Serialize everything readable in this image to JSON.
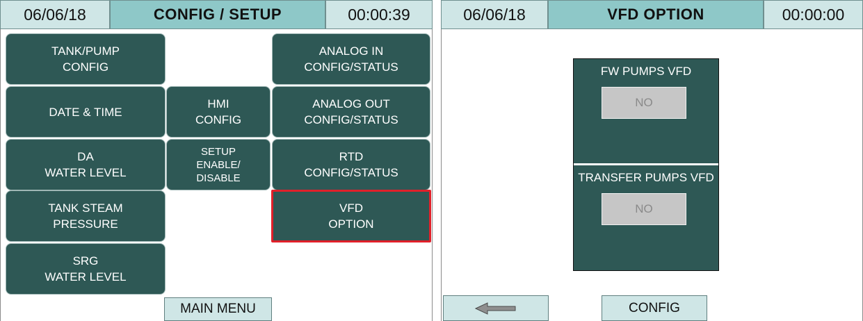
{
  "left": {
    "header": {
      "date": "06/06/18",
      "title": "CONFIG / SETUP",
      "time": "00:00:39"
    },
    "tiles": {
      "tank_pump": "TANK/PUMP\nCONFIG",
      "date_time": "DATE & TIME",
      "da_level": "DA\nWATER LEVEL",
      "tank_steam": "TANK STEAM\nPRESSURE",
      "srg_level": "SRG\nWATER LEVEL",
      "hmi_config": "HMI\nCONFIG",
      "setup_enable": "SETUP\nENABLE/\nDISABLE",
      "analog_in": "ANALOG IN\nCONFIG/STATUS",
      "analog_out": "ANALOG OUT\nCONFIG/STATUS",
      "rtd": "RTD\nCONFIG/STATUS",
      "vfd_option": "VFD\nOPTION"
    },
    "main_menu_label": "MAIN MENU"
  },
  "right": {
    "header": {
      "date": "06/06/18",
      "title": "VFD OPTION",
      "time": "00:00:00"
    },
    "fw_label": "FW PUMPS VFD",
    "fw_value": "NO",
    "transfer_label": "TRANSFER PUMPS VFD",
    "transfer_value": "NO",
    "back_icon": "arrow-left-icon",
    "config_label": "CONFIG"
  },
  "colors": {
    "tile": "#2e5855",
    "header_light": "#cfe6e6",
    "header_title": "#8ec8c8",
    "selected_border": "#e0202a"
  }
}
